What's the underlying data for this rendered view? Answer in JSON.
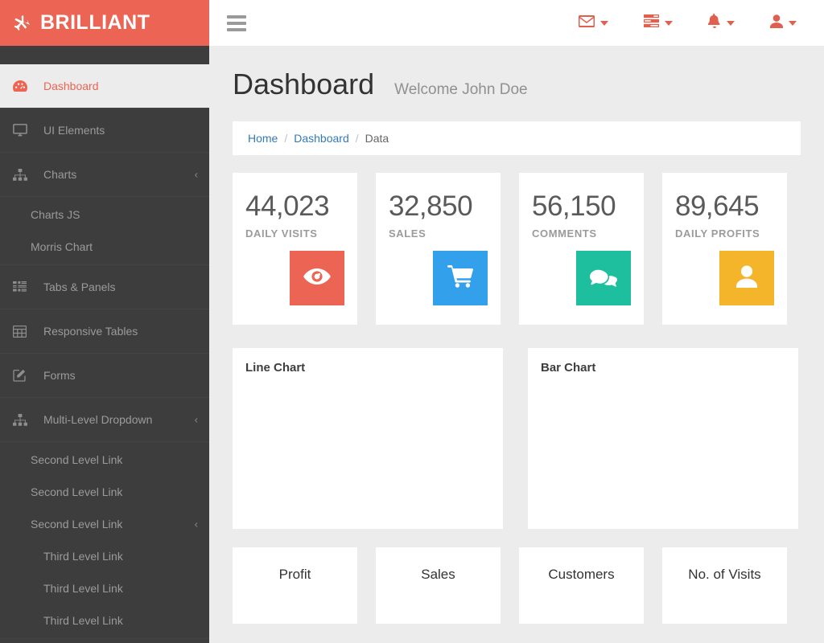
{
  "brand": {
    "name": "BRILLIANT",
    "icon": "plane-icon",
    "color": "#ec6453"
  },
  "navbar": {
    "menu_toggle": "hamburger-icon",
    "items": [
      {
        "icon": "envelope-icon",
        "name": "messages-dropdown"
      },
      {
        "icon": "tasks-icon",
        "name": "tasks-dropdown"
      },
      {
        "icon": "bell-icon",
        "name": "notifications-dropdown"
      },
      {
        "icon": "user-icon",
        "name": "user-dropdown"
      }
    ]
  },
  "sidebar": {
    "items": [
      {
        "label": "Dashboard",
        "icon": "tachometer-icon",
        "active": true,
        "expandable": false
      },
      {
        "label": "UI Elements",
        "icon": "desktop-icon",
        "active": false,
        "expandable": false
      },
      {
        "label": "Charts",
        "icon": "sitemap-icon",
        "active": false,
        "expandable": true
      }
    ],
    "charts_children": [
      {
        "label": "Charts JS"
      },
      {
        "label": "Morris Chart"
      }
    ],
    "items2": [
      {
        "label": "Tabs & Panels",
        "icon": "th-list-icon",
        "active": false,
        "expandable": false
      },
      {
        "label": "Responsive Tables",
        "icon": "table-icon",
        "active": false,
        "expandable": false
      },
      {
        "label": "Forms",
        "icon": "pencil-square-icon",
        "active": false,
        "expandable": false
      },
      {
        "label": "Multi-Level Dropdown",
        "icon": "sitemap-icon",
        "active": false,
        "expandable": true
      }
    ],
    "multilevel_children": [
      {
        "label": "Second Level Link",
        "expandable": false
      },
      {
        "label": "Second Level Link",
        "expandable": false
      },
      {
        "label": "Second Level Link",
        "expandable": true
      }
    ],
    "third_level": [
      {
        "label": "Third Level Link"
      },
      {
        "label": "Third Level Link"
      },
      {
        "label": "Third Level Link"
      }
    ],
    "collapse_arrow": "‹"
  },
  "page": {
    "title": "Dashboard",
    "welcome": "Welcome John Doe"
  },
  "breadcrumb": {
    "home": "Home",
    "dashboard": "Dashboard",
    "current": "Data",
    "separator": "/"
  },
  "stats": [
    {
      "value": "44,023",
      "label": "DAILY VISITS",
      "icon": "eye-icon",
      "color": "#ec6453"
    },
    {
      "value": "32,850",
      "label": "SALES",
      "icon": "shopping-cart-icon",
      "color": "#32a0ea"
    },
    {
      "value": "56,150",
      "label": "COMMENTS",
      "icon": "comments-icon",
      "color": "#1dbf9e"
    },
    {
      "value": "89,645",
      "label": "DAILY PROFITS",
      "icon": "user-icon",
      "color": "#f5b52b"
    }
  ],
  "chart_panels": [
    {
      "title": "Line Chart"
    },
    {
      "title": "Bar Chart"
    }
  ],
  "bottom_cards": [
    {
      "label": "Profit"
    },
    {
      "label": "Sales"
    },
    {
      "label": "Customers"
    },
    {
      "label": "No. of Visits"
    }
  ]
}
